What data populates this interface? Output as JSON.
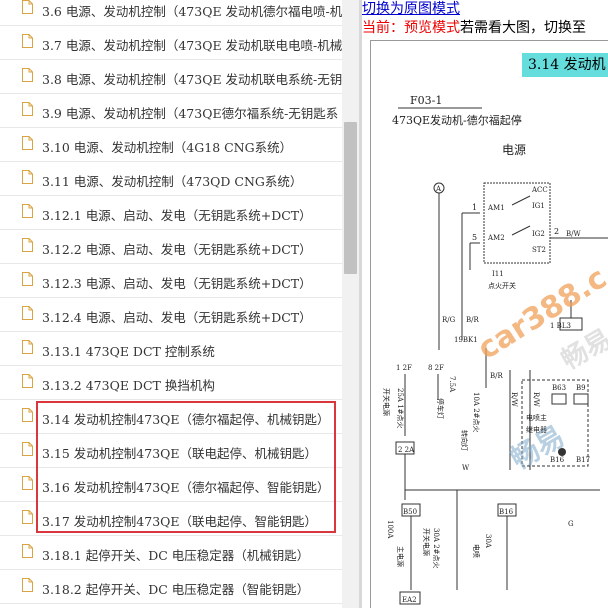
{
  "doc_list": {
    "items": [
      {
        "label": "3.6 电源、发动机控制（473QE 发动机德尔福电喷-机"
      },
      {
        "label": "3.7 电源、发动机控制（473QE 发动机联电电喷-机械"
      },
      {
        "label": "3.8 电源、发动机控制（473QE 发动机联电系统-无钥"
      },
      {
        "label": "3.9 电源、发动机控制（473QE德尔福系统-无钥匙系"
      },
      {
        "label": "3.10 电源、发动机控制（4G18 CNG系统）"
      },
      {
        "label": "3.11 电源、发动机控制（473QD CNG系统）"
      },
      {
        "label": "3.12.1 电源、启动、发电（无钥匙系统+DCT）"
      },
      {
        "label": "3.12.2 电源、启动、发电（无钥匙系统+DCT）"
      },
      {
        "label": "3.12.3 电源、启动、发电（无钥匙系统+DCT）"
      },
      {
        "label": "3.12.4 电源、启动、发电（无钥匙系统+DCT）"
      },
      {
        "label": "3.13.1 473QE DCT 控制系统"
      },
      {
        "label": "3.13.2 473QE DCT 换挡机构"
      },
      {
        "label": "3.14 发动机控制473QE（德尔福起停、机械钥匙）"
      },
      {
        "label": "3.15 发动机控制473QE（联电起停、机械钥匙）"
      },
      {
        "label": "3.16 发动机控制473QE（德尔福起停、智能钥匙）"
      },
      {
        "label": "3.17 发动机控制473QE（联电起停、智能钥匙）"
      },
      {
        "label": "3.18.1 起停开关、DC 电压稳定器（机械钥匙）"
      },
      {
        "label": "3.18.2 起停开关、DC 电压稳定器（智能钥匙）"
      }
    ]
  },
  "viewer": {
    "switch_link": "切换为原图模式",
    "mode_prefix": "当前：",
    "mode_name": "预览模式",
    "mode_hint": "若需看大图，切换至",
    "section_title": "3.14  发动机"
  },
  "diagram": {
    "code": "F03-1",
    "heading": "473QE发动机-德尔福起停",
    "subheading": "电源",
    "node_a": "A",
    "am1": "AM1",
    "am2": "AM2",
    "acc": "ACC",
    "ig1": "IG1",
    "ig2": "IG2",
    "st2": "ST2",
    "pin1": "1",
    "pin5": "5",
    "pin2": "2",
    "pin6": "6",
    "bw": "B/W",
    "switch_id": "I11",
    "switch_name": "点火开关",
    "rg": "R/G",
    "br": "B/R",
    "bk1": "19BK1",
    "bl3": "1 BL3",
    "f2_1": "1 2F",
    "f2_8": "8 2F",
    "fuse1": "25A 1#点火",
    "fuse1b": "开关电源",
    "fuse2": "7.5A",
    "fuse2b": "停车灯",
    "fuse3": "10A 2#点火",
    "fuse3b": "转向灯",
    "rw1": "R/W",
    "rw2": "R/W",
    "b63": "B63",
    "b9": "B9",
    "relay1": "电喷主",
    "relay2": "继电器",
    "b16a": "B16",
    "b17": "B17",
    "a2": "2 2A",
    "w": "W",
    "b50": "B50",
    "b16b": "B16",
    "fuse4": "100A",
    "fuse4b": "主电源",
    "fuse5": "30A 2#点火",
    "fuse5b": "开关电源",
    "fuse6": "30A",
    "fuse6b": "电喷",
    "g": "G",
    "ea2": "EA2"
  },
  "watermarks": {
    "site": "car388.c",
    "brand_a": "畅易",
    "brand_b": "畅易"
  },
  "colors": {
    "highlight_border": "#d9363e",
    "link": "#0000cc",
    "mode_red": "#ee0000",
    "title_bg": "#66dddd",
    "watermark": "#f0a05a"
  }
}
